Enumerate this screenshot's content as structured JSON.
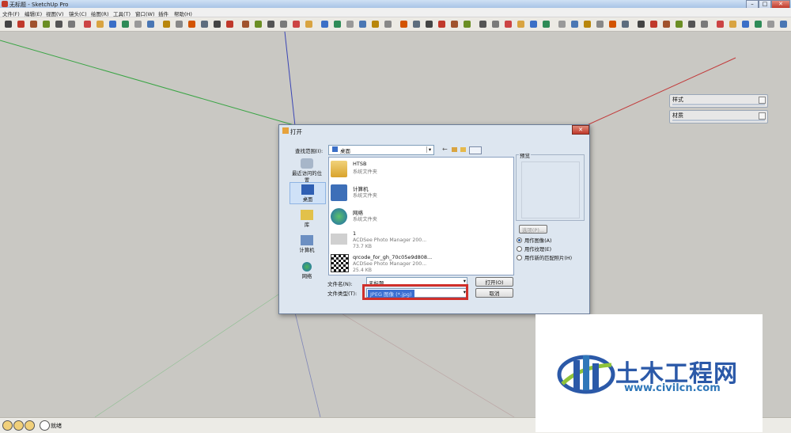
{
  "window": {
    "title": "无标题 - SketchUp Pro",
    "min": "–",
    "max": "□",
    "close": "✕"
  },
  "menu": [
    "文件(F)",
    "编辑(E)",
    "视图(V)",
    "镜头(C)",
    "绘图(R)",
    "工具(T)",
    "窗口(W)",
    "插件",
    "帮助(H)"
  ],
  "tray": {
    "styles": "样式",
    "materials": "材质"
  },
  "dialog": {
    "title": "打开",
    "close": "✕",
    "look_in_label": "查找范围(I):",
    "look_in_value": "桌面",
    "places": [
      "最近访问的位置",
      "桌面",
      "库",
      "计算机",
      "网络"
    ],
    "files": [
      {
        "name": "HTSB",
        "line1": "系统文件夹",
        "line2": ""
      },
      {
        "name": "计算机",
        "line1": "系统文件夹",
        "line2": ""
      },
      {
        "name": "网络",
        "line1": "系统文件夹",
        "line2": ""
      },
      {
        "name": "1",
        "line1": "ACDSee Photo Manager 200...",
        "line2": "73.7 KB"
      },
      {
        "name": "qrcode_for_gh_70c05e9d808...",
        "line1": "ACDSee Photo Manager 200...",
        "line2": "25.4 KB"
      }
    ],
    "preview_label": "预览",
    "options_button": "选项(P)...",
    "radios": [
      "用作图像(A)",
      "用作纹理(E)",
      "用作新的匹配照片(H)"
    ],
    "filename_label": "文件名(N):",
    "filename_value": "无标题",
    "filetype_label": "文件类型(T):",
    "filetype_value": "JPEG 图像 (*.jpg)",
    "open_button": "打开(O)",
    "cancel_button": "取消"
  },
  "status": {
    "text": "就绪"
  },
  "watermark": {
    "title": "土木工程网",
    "url": "www.civilcn.com"
  },
  "colors": {
    "axis_red": "#c23b3b",
    "axis_green": "#3aa545",
    "axis_blue": "#3a45b5",
    "highlight": "#d0302b"
  }
}
